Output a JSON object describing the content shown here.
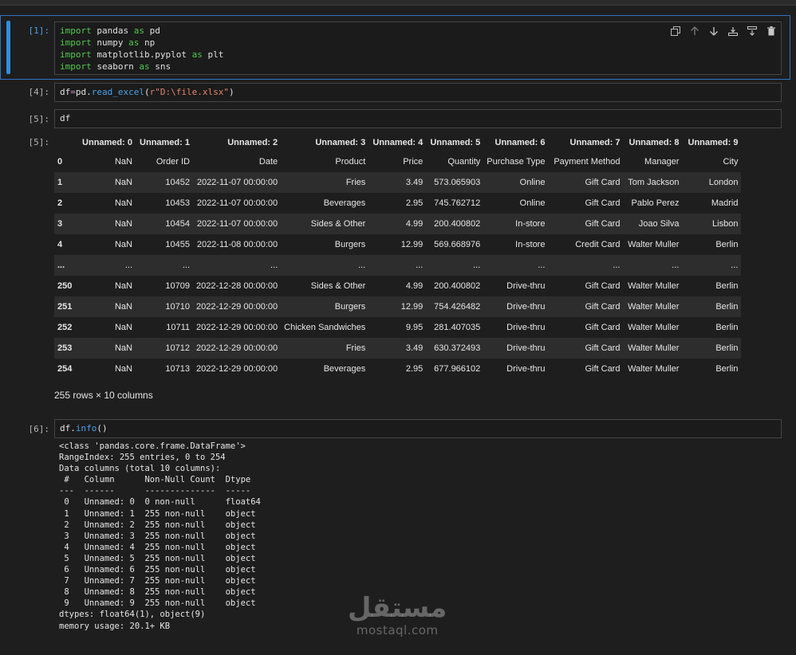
{
  "cells": {
    "c1": {
      "prompt": "[1]:"
    },
    "c4": {
      "prompt": "[4]:"
    },
    "c5": {
      "prompt": "[5]:",
      "code": "df",
      "out_prompt": "[5]:"
    },
    "c6": {
      "prompt": "[6]:"
    }
  },
  "toolbar": {
    "copy_icon": "copy-icon",
    "up_icon": "arrow-up-icon",
    "down_icon": "arrow-down-icon",
    "insert_above_icon": "insert-above-icon",
    "insert_below_icon": "insert-below-icon",
    "delete_icon": "trash-icon"
  },
  "dataframe": {
    "columns": [
      "Unnamed: 0",
      "Unnamed: 1",
      "Unnamed: 2",
      "Unnamed: 3",
      "Unnamed: 4",
      "Unnamed: 5",
      "Unnamed: 6",
      "Unnamed: 7",
      "Unnamed: 8",
      "Unnamed: 9"
    ],
    "rows": [
      [
        "0",
        "NaN",
        "Order ID",
        "Date",
        "Product",
        "Price",
        "Quantity",
        "Purchase Type",
        "Payment Method",
        "Manager",
        "City"
      ],
      [
        "1",
        "NaN",
        "10452",
        "2022-11-07 00:00:00",
        "Fries",
        "3.49",
        "573.065903",
        "Online",
        "Gift Card",
        "Tom Jackson",
        "London"
      ],
      [
        "2",
        "NaN",
        "10453",
        "2022-11-07 00:00:00",
        "Beverages",
        "2.95",
        "745.762712",
        "Online",
        "Gift Card",
        "Pablo Perez",
        "Madrid"
      ],
      [
        "3",
        "NaN",
        "10454",
        "2022-11-07 00:00:00",
        "Sides & Other",
        "4.99",
        "200.400802",
        "In-store",
        "Gift Card",
        "Joao Silva",
        "Lisbon"
      ],
      [
        "4",
        "NaN",
        "10455",
        "2022-11-08 00:00:00",
        "Burgers",
        "12.99",
        "569.668976",
        "In-store",
        "Credit Card",
        "Walter Muller",
        "Berlin"
      ],
      [
        "...",
        "...",
        "...",
        "...",
        "...",
        "...",
        "...",
        "...",
        "...",
        "...",
        "..."
      ],
      [
        "250",
        "NaN",
        "10709",
        "2022-12-28 00:00:00",
        "Sides & Other",
        "4.99",
        "200.400802",
        "Drive-thru",
        "Gift Card",
        "Walter Muller",
        "Berlin"
      ],
      [
        "251",
        "NaN",
        "10710",
        "2022-12-29 00:00:00",
        "Burgers",
        "12.99",
        "754.426482",
        "Drive-thru",
        "Gift Card",
        "Walter Muller",
        "Berlin"
      ],
      [
        "252",
        "NaN",
        "10711",
        "2022-12-29 00:00:00",
        "Chicken Sandwiches",
        "9.95",
        "281.407035",
        "Drive-thru",
        "Gift Card",
        "Walter Muller",
        "Berlin"
      ],
      [
        "253",
        "NaN",
        "10712",
        "2022-12-29 00:00:00",
        "Fries",
        "3.49",
        "630.372493",
        "Drive-thru",
        "Gift Card",
        "Walter Muller",
        "Berlin"
      ],
      [
        "254",
        "NaN",
        "10713",
        "2022-12-29 00:00:00",
        "Beverages",
        "2.95",
        "677.966102",
        "Drive-thru",
        "Gift Card",
        "Walter Muller",
        "Berlin"
      ]
    ],
    "shape_text": "255 rows × 10 columns"
  },
  "info_output": "<class 'pandas.core.frame.DataFrame'>\nRangeIndex: 255 entries, 0 to 254\nData columns (total 10 columns):\n #   Column      Non-Null Count  Dtype  \n---  ------      --------------  -----  \n 0   Unnamed: 0  0 non-null      float64\n 1   Unnamed: 1  255 non-null    object \n 2   Unnamed: 2  255 non-null    object \n 3   Unnamed: 3  255 non-null    object \n 4   Unnamed: 4  255 non-null    object \n 5   Unnamed: 5  255 non-null    object \n 6   Unnamed: 6  255 non-null    object \n 7   Unnamed: 7  255 non-null    object \n 8   Unnamed: 8  255 non-null    object \n 9   Unnamed: 9  255 non-null    object \ndtypes: float64(1), object(9)\nmemory usage: 20.1+ KB",
  "watermark": {
    "arabic": "مستقل",
    "latin": "mostaql.com"
  }
}
